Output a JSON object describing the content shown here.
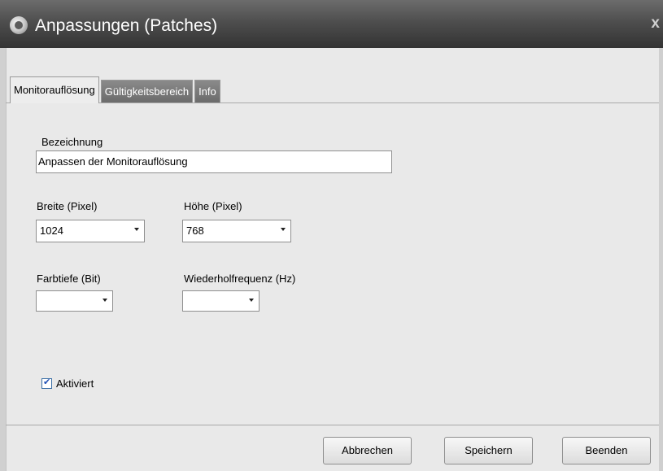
{
  "window": {
    "title": "Anpassungen (Patches)",
    "close_glyph": "x"
  },
  "tabs": [
    {
      "label": "Monitorauflösung",
      "active": true
    },
    {
      "label": "Gültigkeitsbereich",
      "active": false
    },
    {
      "label": "Info",
      "active": false
    }
  ],
  "form": {
    "bezeichnung_label": "Bezeichnung",
    "bezeichnung_value": "Anpassen der Monitorauflösung",
    "breite_label": "Breite (Pixel)",
    "breite_value": "1024",
    "hoehe_label": "Höhe (Pixel)",
    "hoehe_value": "768",
    "farbtiefe_label": "Farbtiefe (Bit)",
    "farbtiefe_value": "",
    "wiederhol_label": "Wiederholfrequenz (Hz)",
    "wiederhol_value": "",
    "aktiviert_label": "Aktiviert",
    "aktiviert_checked": true
  },
  "buttons": {
    "cancel": "Abbrechen",
    "save": "Speichern",
    "exit": "Beenden"
  },
  "colors": {
    "titlebar": "#4e4e4e",
    "tab_inactive": "#7a7a7a",
    "checkbox_accent": "#1f4fb5"
  }
}
